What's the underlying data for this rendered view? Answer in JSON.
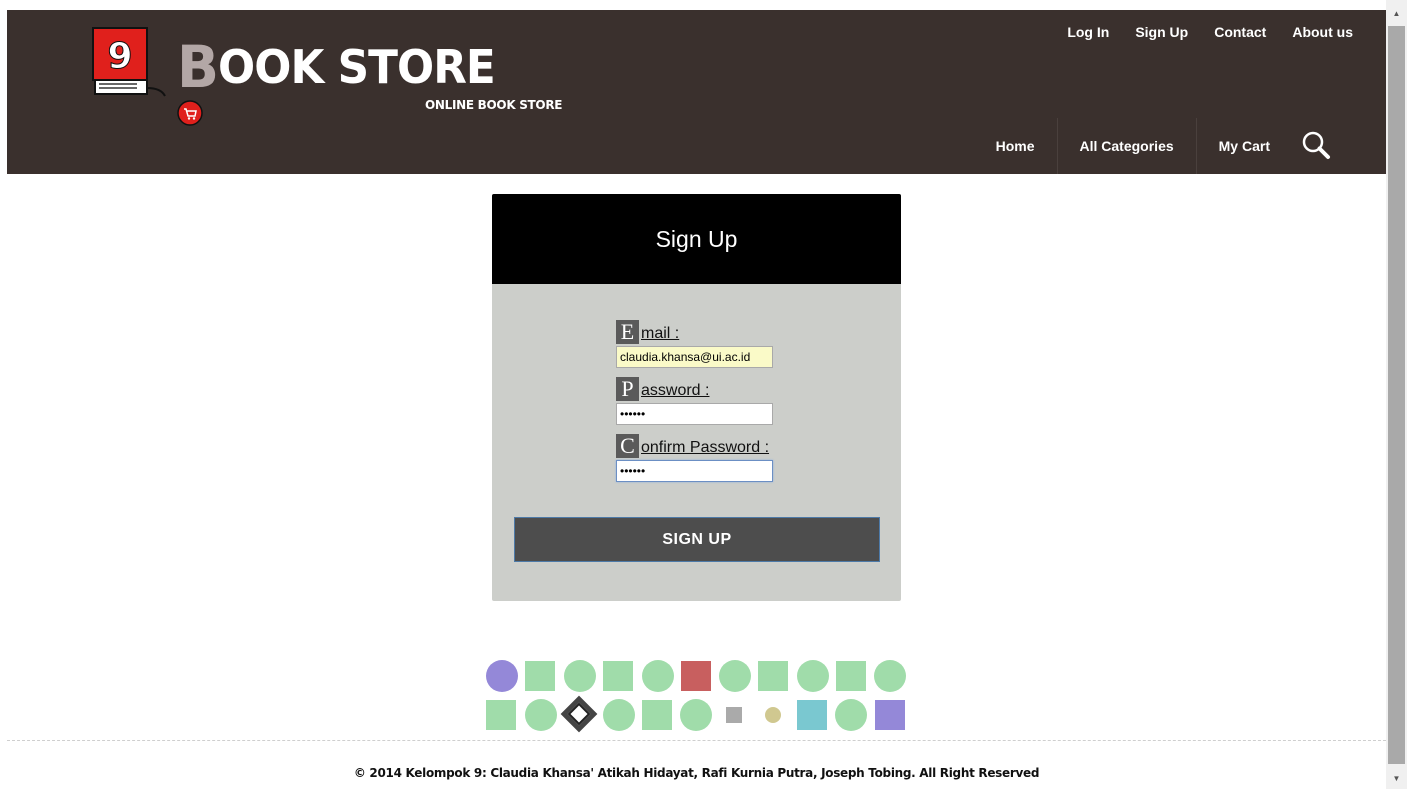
{
  "brand": {
    "logo_number": "9",
    "logo_big_letter": "B",
    "logo_rest": "OOK STORE",
    "tagline": "ONLINE BOOK STORE"
  },
  "top_links": [
    {
      "label": "Log In"
    },
    {
      "label": "Sign Up"
    },
    {
      "label": "Contact"
    },
    {
      "label": "About us"
    }
  ],
  "main_nav": [
    {
      "label": "Home"
    },
    {
      "label": "All Categories"
    },
    {
      "label": "My Cart"
    }
  ],
  "form": {
    "title": "Sign Up",
    "email": {
      "cap": "E",
      "label": "mail :",
      "value": "claudia.khansa@ui.ac.id"
    },
    "password": {
      "cap": "P",
      "label": "assword :",
      "value": "••••••"
    },
    "confirm": {
      "cap": "C",
      "label": "onfirm Password :",
      "value": "••••••"
    },
    "submit_label": "SIGN UP"
  },
  "colors": {
    "header_bg": "#3a302d",
    "card_bg": "#ccceca",
    "shape_green": "#a0dcaa",
    "shape_purple": "#9488d8",
    "shape_red": "#c85f5f",
    "shape_teal": "#7ac8d0",
    "shape_gray": "#aaaaaa",
    "shape_olive": "#d0c890"
  },
  "footer": {
    "text": "© 2014 Kelompok 9: Claudia Khansa' Atikah Hidayat, Rafi Kurnia Putra, Joseph Tobing. All Right Reserved"
  }
}
